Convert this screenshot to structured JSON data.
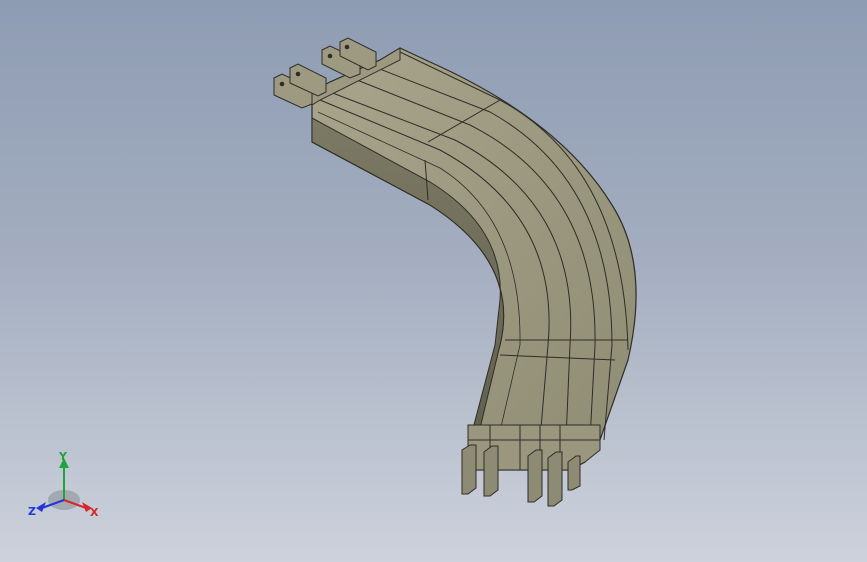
{
  "viewport": {
    "background_top": "#8e9cb3",
    "background_bottom": "#cdd2dc",
    "model": {
      "name": "curved-busbar-bend",
      "face_color": "#8d8b74",
      "face_light": "#a6a38a",
      "face_dark": "#6f6d5a",
      "edge_color": "#2e2d26"
    }
  },
  "triad": {
    "x_label": "X",
    "y_label": "Y",
    "z_label": "Z",
    "x_color": "#d8262b",
    "y_color": "#1fa33a",
    "z_color": "#2436d8"
  }
}
